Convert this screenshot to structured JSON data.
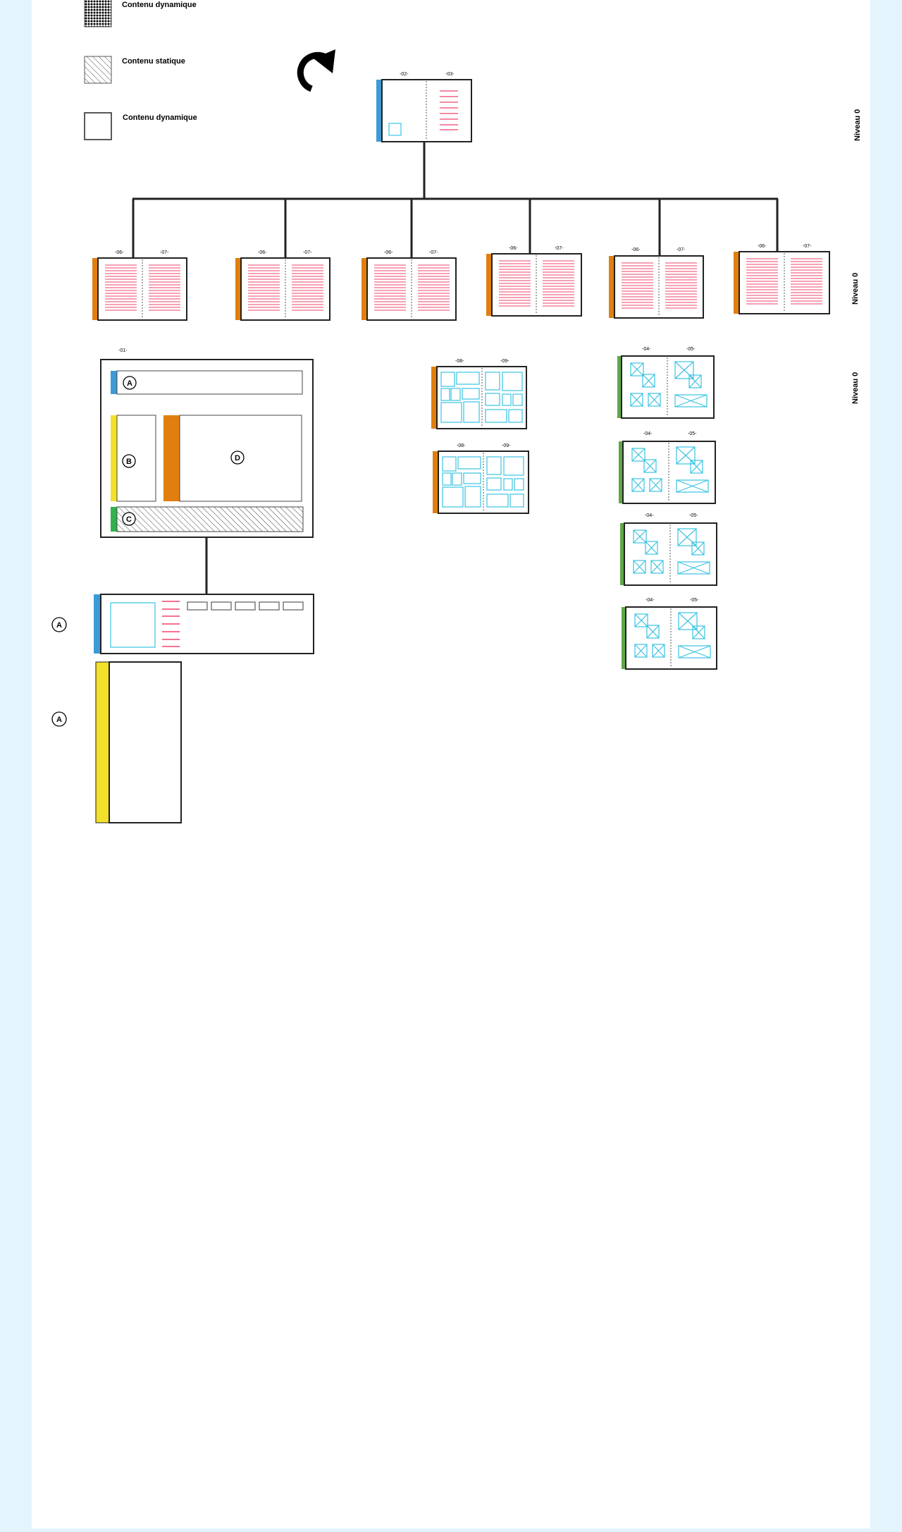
{
  "colors": {
    "blue": "#3d9ad6",
    "orange": "#e07f10",
    "green": "#5fa748",
    "yellow": "#f2e02b",
    "bright_green": "#2fb34a",
    "red_lines": "#f0436a",
    "cyan": "#3ac3e2",
    "background": "#e3f4fd"
  },
  "legend": [
    {
      "label": "Contenu dynamique",
      "icon": "dot-pattern-swatch"
    },
    {
      "label": "Contenu statique",
      "icon": "hatch-pattern-swatch"
    },
    {
      "label": "Contenu dynamique",
      "icon": "empty-square-swatch"
    }
  ],
  "refresh_icon": "refresh-icon",
  "levels": [
    "Niveau 0",
    "Niveau 0",
    "Niveau 0"
  ],
  "root_spread": {
    "pages": [
      "-02-",
      "-03-"
    ]
  },
  "text_spreads": [
    {
      "pages": [
        "-06-",
        "-07-"
      ]
    },
    {
      "pages": [
        "-06-",
        "-07-"
      ]
    },
    {
      "pages": [
        "-06-",
        "-07-"
      ]
    },
    {
      "pages": [
        "-06-",
        "-07-"
      ]
    },
    {
      "pages": [
        "-06-",
        "-07-"
      ]
    },
    {
      "pages": [
        "-06-",
        "-07-"
      ]
    }
  ],
  "layout_template": {
    "page": "-01-",
    "zones": [
      "A",
      "B",
      "C",
      "D"
    ]
  },
  "grid_spreads": [
    {
      "pages": [
        "-08-",
        "-09-"
      ]
    },
    {
      "pages": [
        "-08-",
        "-09-"
      ]
    }
  ],
  "image_spreads": [
    {
      "pages": [
        "-04-",
        "-05-"
      ]
    },
    {
      "pages": [
        "-04-",
        "-05-"
      ]
    },
    {
      "pages": [
        "-04-",
        "-05-"
      ]
    },
    {
      "pages": [
        "-04-",
        "-05-"
      ]
    }
  ],
  "detail_markers": [
    "A",
    "A"
  ]
}
